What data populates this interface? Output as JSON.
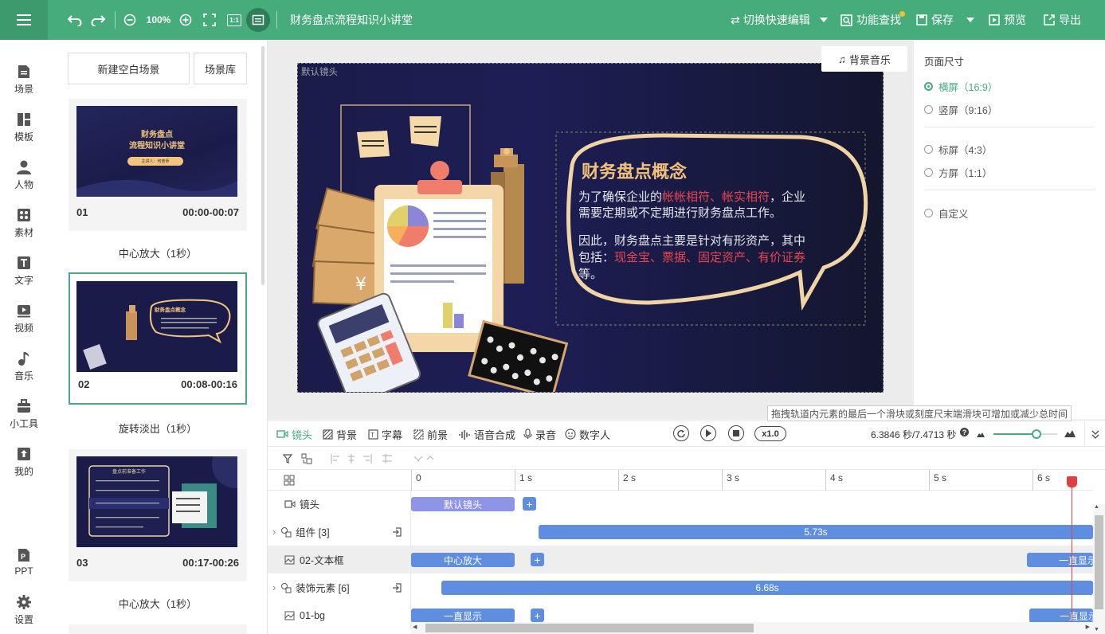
{
  "topbar": {
    "zoom": "100%",
    "ratio_label": "1:1",
    "doc_title": "财务盘点流程知识小讲堂",
    "quick_edit": "切换快速编辑",
    "find": "功能查找",
    "save": "保存",
    "preview": "预览",
    "export": "导出"
  },
  "sidebar": {
    "items": [
      {
        "label": "场景",
        "icon": "scene-icon"
      },
      {
        "label": "模板",
        "icon": "template-icon"
      },
      {
        "label": "人物",
        "icon": "person-icon"
      },
      {
        "label": "素材",
        "icon": "material-icon"
      },
      {
        "label": "文字",
        "icon": "text-icon"
      },
      {
        "label": "视频",
        "icon": "video-icon"
      },
      {
        "label": "音乐",
        "icon": "music-icon"
      },
      {
        "label": "小工具",
        "icon": "toolbox-icon"
      },
      {
        "label": "我的",
        "icon": "upload-icon"
      }
    ],
    "bottom": [
      {
        "label": "PPT",
        "icon": "ppt-icon"
      },
      {
        "label": "设置",
        "icon": "gear-icon"
      }
    ]
  },
  "scenes": {
    "new_blank": "新建空白场景",
    "library": "场景库",
    "list": [
      {
        "num": "01",
        "time": "00:00-00:07",
        "transition": "中心放大（1秒）",
        "thumb_title1": "财务盘点",
        "thumb_title2": "流程知识小讲堂",
        "thumb_pill": "主讲人：何老师"
      },
      {
        "num": "02",
        "time": "00:08-00:16",
        "transition": "旋转淡出（1秒）",
        "thumb_title1": "财务盘点概念"
      },
      {
        "num": "03",
        "time": "00:17-00:26",
        "transition": "中心放大（1秒）",
        "thumb_title1": "盘点前准备工作"
      }
    ]
  },
  "stage": {
    "bgm": "背景音乐",
    "camera_label": "默认镜头",
    "slide": {
      "heading": "财务盘点概念",
      "p1_a": "为了确保企业的",
      "p1_hl": "帐帐相符、帐实相符",
      "p1_b": "，企业需要定期或不定期进行财务盘点工作。",
      "p2_a": "因此，财务盘点主要是针对有形资产，其中包括：",
      "p2_hl": "现金宝、票据、固定资产、有价证券",
      "p2_b": "等。"
    }
  },
  "props": {
    "title": "页面尺寸",
    "options": [
      "横屏（16:9）",
      "竖屏（9:16）",
      "标屏（4:3）",
      "方屏（1:1）",
      "自定义"
    ],
    "selected": 0
  },
  "tooltip": "拖拽轨道内元素的最后一个滑块或刻度尺末端滑块可增加或减少总时间",
  "timeline": {
    "tabs": [
      "镜头",
      "背景",
      "字幕",
      "前景",
      "语音合成",
      "录音",
      "数字人"
    ],
    "speed": "x1.0",
    "time": "6.3846 秒/7.4713 秒",
    "ruler": [
      "0",
      "1 s",
      "2 s",
      "3 s",
      "4 s",
      "5 s",
      "6 s"
    ],
    "tracks": [
      {
        "label": "镜头",
        "segments": [
          {
            "text": "默认镜头"
          }
        ]
      },
      {
        "label": "组件 [3]",
        "segments": [
          {
            "text": "5.73s"
          }
        ]
      },
      {
        "label": "02-文本框",
        "segments": [
          {
            "text": "中心放大"
          },
          {
            "text": "一直显示"
          }
        ]
      },
      {
        "label": "装饰元素 [6]",
        "segments": [
          {
            "text": "6.68s"
          }
        ]
      },
      {
        "label": "01-bg",
        "segments": [
          {
            "text": "一直显示"
          },
          {
            "text": "一直显示"
          }
        ]
      }
    ]
  },
  "colors": {
    "brand": "#46ac7c",
    "segment": "#5f8ee0",
    "camera_segment": "#8e94e6",
    "highlight": "#e8454f",
    "slide_heading": "#f2c07a"
  }
}
